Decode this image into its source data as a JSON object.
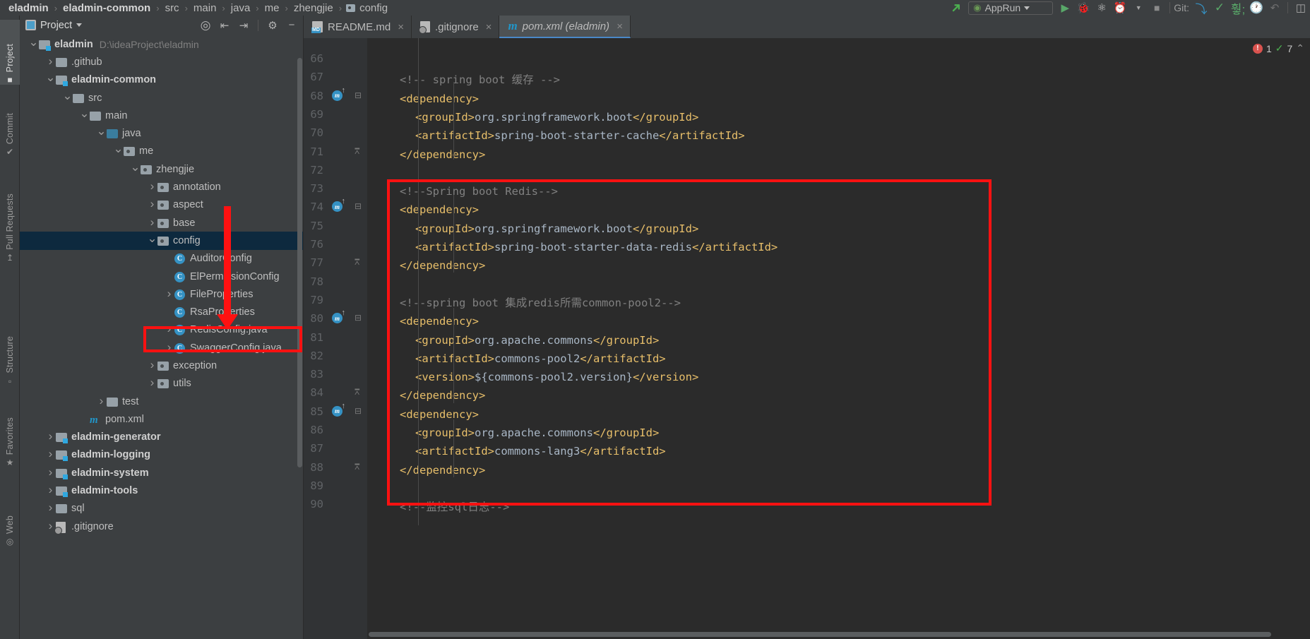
{
  "navbar": {
    "crumbs": [
      {
        "text": "eladmin",
        "bold": true
      },
      {
        "text": "eladmin-common",
        "bold": true
      },
      {
        "text": "src",
        "bold": false
      },
      {
        "text": "main",
        "bold": false
      },
      {
        "text": "java",
        "bold": false
      },
      {
        "text": "me",
        "bold": false
      },
      {
        "text": "zhengjie",
        "bold": false
      },
      {
        "text": "config",
        "bold": false
      }
    ],
    "separator": "›",
    "run_config": "AppRun",
    "git_label": "Git:"
  },
  "left_strip": [
    {
      "label": "Project",
      "icon": "folder-icon",
      "active": true
    },
    {
      "label": "Commit",
      "icon": "commit-icon",
      "active": false
    },
    {
      "label": "Pull Requests",
      "icon": "pull-request-icon",
      "active": false
    },
    {
      "label": "Structure",
      "icon": "structure-icon",
      "active": false
    },
    {
      "label": "Favorites",
      "icon": "star-icon",
      "active": false
    },
    {
      "label": "Web",
      "icon": "web-icon",
      "active": false
    }
  ],
  "project_panel": {
    "title": "Project",
    "tools": [
      "locate-icon",
      "expand-all-icon",
      "collapse-all-icon",
      "gear-icon",
      "hide-icon"
    ],
    "tree": [
      {
        "indent": 0,
        "arrow": "v",
        "icon": "module-icon",
        "label": "eladmin",
        "bold": true,
        "hint": "D:\\ideaProject\\eladmin"
      },
      {
        "indent": 1,
        "arrow": ">",
        "icon": "folder-icon",
        "label": ".github",
        "bold": false
      },
      {
        "indent": 1,
        "arrow": "v",
        "icon": "module-icon",
        "label": "eladmin-common",
        "bold": true
      },
      {
        "indent": 2,
        "arrow": "v",
        "icon": "folder-icon",
        "label": "src",
        "bold": false
      },
      {
        "indent": 3,
        "arrow": "v",
        "icon": "folder-icon",
        "label": "main",
        "bold": false
      },
      {
        "indent": 4,
        "arrow": "v",
        "icon": "source-folder-icon",
        "label": "java",
        "bold": false
      },
      {
        "indent": 5,
        "arrow": "v",
        "icon": "package-icon",
        "label": "me",
        "bold": false
      },
      {
        "indent": 6,
        "arrow": "v",
        "icon": "package-icon",
        "label": "zhengjie",
        "bold": false
      },
      {
        "indent": 7,
        "arrow": ">",
        "icon": "package-icon",
        "label": "annotation",
        "bold": false
      },
      {
        "indent": 7,
        "arrow": ">",
        "icon": "package-icon",
        "label": "aspect",
        "bold": false
      },
      {
        "indent": 7,
        "arrow": ">",
        "icon": "package-icon",
        "label": "base",
        "bold": false
      },
      {
        "indent": 7,
        "arrow": "v",
        "icon": "package-icon",
        "label": "config",
        "bold": false,
        "selected": true
      },
      {
        "indent": 8,
        "arrow": "",
        "icon": "class-icon",
        "label": "AuditorConfig",
        "bold": false
      },
      {
        "indent": 8,
        "arrow": "",
        "icon": "class-icon",
        "label": "ElPermissionConfig",
        "bold": false
      },
      {
        "indent": 8,
        "arrow": ">",
        "icon": "class-icon",
        "label": "FileProperties",
        "bold": false
      },
      {
        "indent": 8,
        "arrow": "",
        "icon": "class-icon",
        "label": "RsaProperties",
        "bold": false
      },
      {
        "indent": 8,
        "arrow": ">",
        "icon": "class-icon",
        "label": "RedisConfig.java",
        "bold": false,
        "highlight": true
      },
      {
        "indent": 8,
        "arrow": ">",
        "icon": "class-icon",
        "label": "SwaggerConfig.java",
        "bold": false
      },
      {
        "indent": 7,
        "arrow": ">",
        "icon": "package-icon",
        "label": "exception",
        "bold": false
      },
      {
        "indent": 7,
        "arrow": ">",
        "icon": "package-icon",
        "label": "utils",
        "bold": false
      },
      {
        "indent": 4,
        "arrow": ">",
        "icon": "folder-icon",
        "label": "test",
        "bold": false
      },
      {
        "indent": 3,
        "arrow": "",
        "icon": "maven-icon",
        "label": "pom.xml",
        "bold": false
      },
      {
        "indent": 1,
        "arrow": ">",
        "icon": "module-icon",
        "label": "eladmin-generator",
        "bold": true
      },
      {
        "indent": 1,
        "arrow": ">",
        "icon": "module-icon",
        "label": "eladmin-logging",
        "bold": true
      },
      {
        "indent": 1,
        "arrow": ">",
        "icon": "module-icon",
        "label": "eladmin-system",
        "bold": true
      },
      {
        "indent": 1,
        "arrow": ">",
        "icon": "module-icon",
        "label": "eladmin-tools",
        "bold": true
      },
      {
        "indent": 1,
        "arrow": ">",
        "icon": "folder-icon",
        "label": "sql",
        "bold": false
      },
      {
        "indent": 1,
        "arrow": ">",
        "icon": "git-icon",
        "label": ".gitignore",
        "bold": false
      }
    ]
  },
  "editor": {
    "tabs": [
      {
        "label": "README.md",
        "icon": "markdown-icon",
        "active": false,
        "close": "×"
      },
      {
        "label": ".gitignore",
        "icon": "gitignore-icon",
        "active": false,
        "close": "×"
      },
      {
        "label": "pom.xml (eladmin)",
        "icon": "maven-icon",
        "active": true,
        "close": "×"
      }
    ],
    "inspection": {
      "error_count": "1",
      "warning_count": "7",
      "collapse": "⌃"
    },
    "lines": [
      {
        "num": "66",
        "indent": 0,
        "spans": [],
        "mark": "",
        "fold": ""
      },
      {
        "num": "67",
        "indent": 2,
        "spans": [
          {
            "t": "cmt",
            "s": "<!-- spring boot 缓存 -->"
          }
        ],
        "mark": "",
        "fold": ""
      },
      {
        "num": "68",
        "indent": 2,
        "spans": [
          {
            "t": "tag",
            "s": "<dependency>"
          }
        ],
        "mark": "maven",
        "fold": "-"
      },
      {
        "num": "69",
        "indent": 3,
        "spans": [
          {
            "t": "tag",
            "s": "<groupId>"
          },
          {
            "t": "txt",
            "s": "org.springframework.boot"
          },
          {
            "t": "tag",
            "s": "</groupId>"
          }
        ],
        "mark": "",
        "fold": ""
      },
      {
        "num": "70",
        "indent": 3,
        "spans": [
          {
            "t": "tag",
            "s": "<artifactId>"
          },
          {
            "t": "txt",
            "s": "spring-boot-starter-cache"
          },
          {
            "t": "tag",
            "s": "</artifactId>"
          }
        ],
        "mark": "",
        "fold": ""
      },
      {
        "num": "71",
        "indent": 2,
        "spans": [
          {
            "t": "tag",
            "s": "</dependency>"
          }
        ],
        "mark": "",
        "fold": "^"
      },
      {
        "num": "72",
        "indent": 0,
        "spans": [],
        "mark": "",
        "fold": ""
      },
      {
        "num": "73",
        "indent": 2,
        "spans": [
          {
            "t": "cmt",
            "s": "<!--Spring boot Redis-->"
          }
        ],
        "mark": "",
        "fold": ""
      },
      {
        "num": "74",
        "indent": 2,
        "spans": [
          {
            "t": "tag",
            "s": "<dependency>"
          }
        ],
        "mark": "maven",
        "fold": "-"
      },
      {
        "num": "75",
        "indent": 3,
        "spans": [
          {
            "t": "tag",
            "s": "<groupId>"
          },
          {
            "t": "txt",
            "s": "org.springframework.boot"
          },
          {
            "t": "tag",
            "s": "</groupId>"
          }
        ],
        "mark": "",
        "fold": ""
      },
      {
        "num": "76",
        "indent": 3,
        "spans": [
          {
            "t": "tag",
            "s": "<artifactId>"
          },
          {
            "t": "txt",
            "s": "spring-boot-starter-data-redis"
          },
          {
            "t": "tag",
            "s": "</artifactId>"
          }
        ],
        "mark": "",
        "fold": ""
      },
      {
        "num": "77",
        "indent": 2,
        "spans": [
          {
            "t": "tag",
            "s": "</dependency>"
          }
        ],
        "mark": "",
        "fold": "^"
      },
      {
        "num": "78",
        "indent": 0,
        "spans": [],
        "mark": "",
        "fold": ""
      },
      {
        "num": "79",
        "indent": 2,
        "spans": [
          {
            "t": "cmt",
            "s": "<!--spring boot 集成redis所需common-pool2-->"
          }
        ],
        "mark": "",
        "fold": ""
      },
      {
        "num": "80",
        "indent": 2,
        "spans": [
          {
            "t": "tag",
            "s": "<dependency>"
          }
        ],
        "mark": "maven",
        "fold": "-"
      },
      {
        "num": "81",
        "indent": 3,
        "spans": [
          {
            "t": "tag",
            "s": "<groupId>"
          },
          {
            "t": "txt",
            "s": "org.apache.commons"
          },
          {
            "t": "tag",
            "s": "</groupId>"
          }
        ],
        "mark": "",
        "fold": ""
      },
      {
        "num": "82",
        "indent": 3,
        "spans": [
          {
            "t": "tag",
            "s": "<artifactId>"
          },
          {
            "t": "txt",
            "s": "commons-pool2"
          },
          {
            "t": "tag",
            "s": "</artifactId>"
          }
        ],
        "mark": "",
        "fold": ""
      },
      {
        "num": "83",
        "indent": 3,
        "spans": [
          {
            "t": "tag",
            "s": "<version>"
          },
          {
            "t": "txt",
            "s": "${commons-pool2.version}"
          },
          {
            "t": "tag",
            "s": "</version>"
          }
        ],
        "mark": "",
        "fold": ""
      },
      {
        "num": "84",
        "indent": 2,
        "spans": [
          {
            "t": "tag",
            "s": "</dependency>"
          }
        ],
        "mark": "",
        "fold": "^"
      },
      {
        "num": "85",
        "indent": 2,
        "spans": [
          {
            "t": "tag",
            "s": "<dependency>"
          }
        ],
        "mark": "maven",
        "fold": "-"
      },
      {
        "num": "86",
        "indent": 3,
        "spans": [
          {
            "t": "tag",
            "s": "<groupId>"
          },
          {
            "t": "txt",
            "s": "org.apache.commons"
          },
          {
            "t": "tag",
            "s": "</groupId>"
          }
        ],
        "mark": "",
        "fold": ""
      },
      {
        "num": "87",
        "indent": 3,
        "spans": [
          {
            "t": "tag",
            "s": "<artifactId>"
          },
          {
            "t": "txt",
            "s": "commons-lang3"
          },
          {
            "t": "tag",
            "s": "</artifactId>"
          }
        ],
        "mark": "",
        "fold": ""
      },
      {
        "num": "88",
        "indent": 2,
        "spans": [
          {
            "t": "tag",
            "s": "</dependency>"
          }
        ],
        "mark": "",
        "fold": "^"
      },
      {
        "num": "89",
        "indent": 0,
        "spans": [],
        "mark": "",
        "fold": ""
      },
      {
        "num": "90",
        "indent": 2,
        "spans": [
          {
            "t": "cmt",
            "s": "<!--监控sql日志-->"
          }
        ],
        "mark": "",
        "fold": ""
      }
    ]
  },
  "colors": {
    "accent": "#3592c4",
    "annotation_red": "#ff1111",
    "tag": "#e8bf6a",
    "text": "#a9b7c6",
    "comment": "#808080",
    "selection": "#0d293e"
  }
}
